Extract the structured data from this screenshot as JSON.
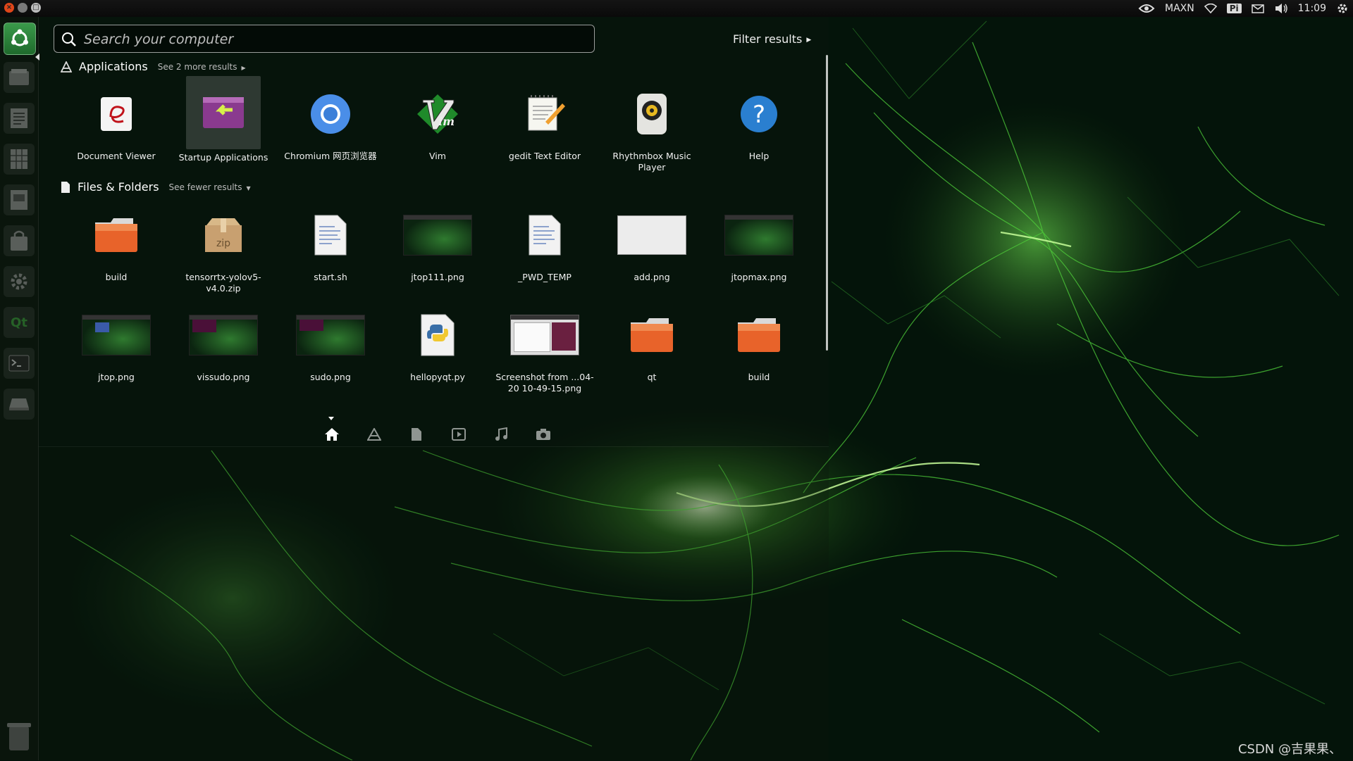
{
  "top_panel": {
    "close_label": "×",
    "min_label": "",
    "max_label": "□",
    "indicators": {
      "power_mode": "MAXN",
      "keyboard": "Pi",
      "clock": "11:09"
    }
  },
  "launcher": {
    "items": [
      "dash",
      "files",
      "writer",
      "calc",
      "impress",
      "software-center",
      "settings",
      "qt-creator",
      "terminal",
      "drive"
    ],
    "qt_label": "Qt"
  },
  "search": {
    "placeholder": "Search your computer",
    "value": ""
  },
  "filter": {
    "label": "Filter results"
  },
  "applications": {
    "title": "Applications",
    "more_label": "See 2 more results",
    "items": [
      {
        "label": "Document Viewer",
        "icon": "document-viewer-icon"
      },
      {
        "label": "Startup Applications",
        "icon": "startup-applications-icon"
      },
      {
        "label": "Chromium 网页浏览器",
        "icon": "chromium-icon"
      },
      {
        "label": "Vim",
        "icon": "vim-icon"
      },
      {
        "label": "gedit Text Editor",
        "icon": "gedit-icon"
      },
      {
        "label": "Rhythmbox Music Player",
        "icon": "rhythmbox-icon"
      },
      {
        "label": "Help",
        "icon": "help-icon"
      }
    ]
  },
  "files": {
    "title": "Files & Folders",
    "fewer_label": "See fewer results",
    "row1": [
      {
        "label": "build",
        "icon": "folder-icon"
      },
      {
        "label": "tensorrtx-yolov5-v4.0.zip",
        "icon": "zip-icon"
      },
      {
        "label": "start.sh",
        "icon": "text-file-icon"
      },
      {
        "label": "jtop111.png",
        "icon": "image-thumbnail"
      },
      {
        "label": "_PWD_TEMP",
        "icon": "text-file-icon"
      },
      {
        "label": "add.png",
        "icon": "blank-image-thumbnail"
      },
      {
        "label": "jtopmax.png",
        "icon": "image-thumbnail"
      }
    ],
    "row2": [
      {
        "label": "jtop.png",
        "icon": "image-thumbnail"
      },
      {
        "label": "vissudo.png",
        "icon": "image-thumbnail"
      },
      {
        "label": "sudo.png",
        "icon": "image-thumbnail"
      },
      {
        "label": "hellopyqt.py",
        "icon": "python-file-icon"
      },
      {
        "label": "Screenshot from ...04-20 10-49-15.png",
        "icon": "screenshot-thumbnail"
      },
      {
        "label": "qt",
        "icon": "folder-icon"
      },
      {
        "label": "build",
        "icon": "folder-icon"
      }
    ],
    "zip_text": "zip"
  },
  "lenses": [
    "home",
    "applications",
    "files",
    "video",
    "music",
    "photo"
  ],
  "watermark": "CSDN @吉果果、",
  "colors": {
    "accent_green": "#3fbf3f",
    "folder_orange": "#e8632a",
    "help_blue": "#2a7fd0"
  }
}
